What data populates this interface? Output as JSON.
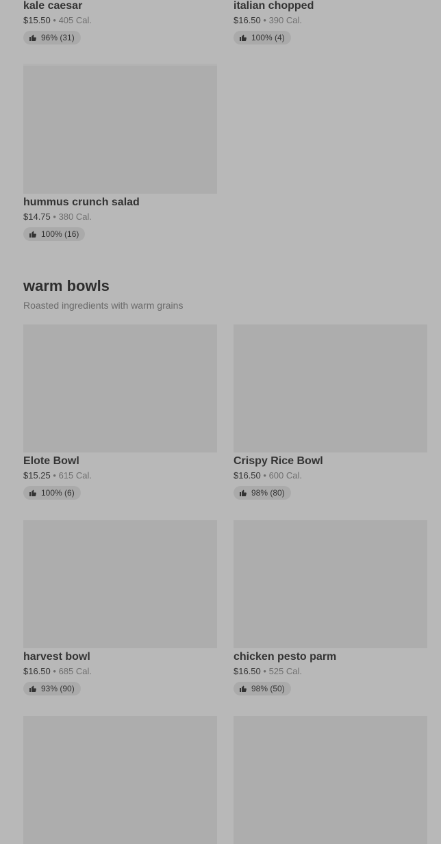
{
  "thumb_icon": "thumbs-up-icon",
  "cards_top": [
    {
      "name": "kale caesar",
      "price": "$15.50",
      "cal": "405 Cal.",
      "rating": "96% (31)"
    },
    {
      "name": "italian chopped",
      "price": "$16.50",
      "cal": "390 Cal.",
      "rating": "100% (4)"
    }
  ],
  "card_hummus": {
    "name": "hummus crunch salad",
    "price": "$14.75",
    "cal": "380 Cal.",
    "rating": "100% (16)"
  },
  "section": {
    "title": "warm bowls",
    "subtitle": "Roasted ingredients with warm grains"
  },
  "cards_warm": [
    {
      "name": "Elote Bowl",
      "price": "$15.25",
      "cal": "615 Cal.",
      "rating": "100% (6)"
    },
    {
      "name": "Crispy Rice Bowl",
      "price": "$16.50",
      "cal": "600 Cal.",
      "rating": "98% (80)"
    },
    {
      "name": "harvest bowl",
      "price": "$16.50",
      "cal": "685 Cal.",
      "rating": "93% (90)"
    },
    {
      "name": "chicken pesto parm",
      "price": "$16.50",
      "cal": "525 Cal.",
      "rating": "98% (50)"
    }
  ],
  "colors": {
    "background": "#b8b8b8",
    "image_placeholder": "#adadad",
    "badge": "#aaaaaa"
  }
}
